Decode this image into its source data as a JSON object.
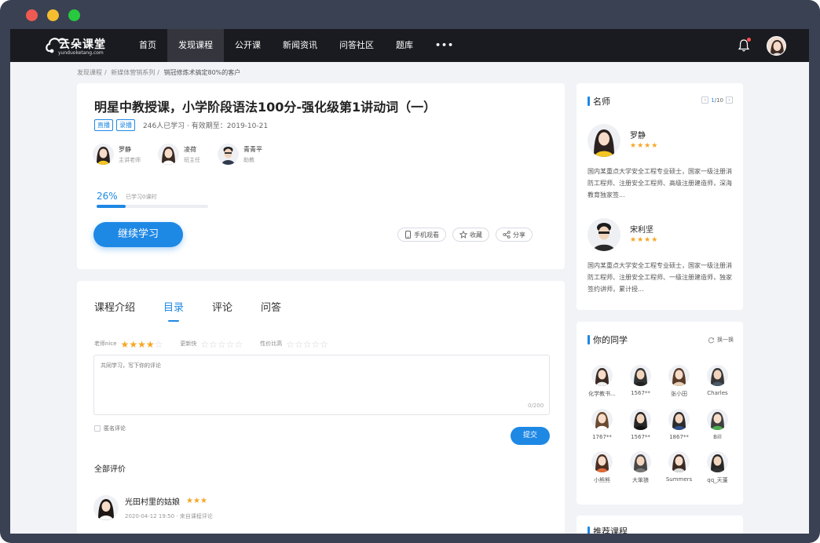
{
  "nav": {
    "logo_text": "云朵课堂",
    "logo_sub": "yunduoketang.com",
    "items": [
      {
        "label": "首页",
        "active": false
      },
      {
        "label": "发现课程",
        "active": true
      },
      {
        "label": "公开课",
        "active": false
      },
      {
        "label": "新闻资讯",
        "active": false
      },
      {
        "label": "问答社区",
        "active": false
      },
      {
        "label": "题库",
        "active": false
      }
    ],
    "more_label": "•••"
  },
  "breadcrumb": [
    "发现课程",
    "新媒体营销系列",
    "销冠修炼术搞定80%的客户"
  ],
  "course": {
    "title": "明星中教授课，小学阶段语法100分-强化级第1讲动词（一）",
    "tags": [
      "直播",
      "录播"
    ],
    "meta": "246人已学习 · 有效期至：2019-10-21",
    "teachers": [
      {
        "name": "罗静",
        "role": "主讲老师"
      },
      {
        "name": "凌荷",
        "role": "班主任"
      },
      {
        "name": "青青平",
        "role": "助教"
      }
    ],
    "progress_text": "26%",
    "progress_value": 0.26,
    "progress_note": "已学习0课时",
    "continue_label": "继续学习",
    "actions": {
      "mobile": "手机观看",
      "favorite": "收藏",
      "share": "分享"
    }
  },
  "tabs": [
    {
      "label": "课程介绍",
      "active": false
    },
    {
      "label": "目录",
      "active": true
    },
    {
      "label": "评论",
      "active": false
    },
    {
      "label": "问答",
      "active": false
    }
  ],
  "ratings": [
    {
      "label": "老师nice",
      "stars": 4
    },
    {
      "label": "更新快",
      "stars": 0
    },
    {
      "label": "性价比高",
      "stars": 0
    }
  ],
  "comment": {
    "placeholder": "共同学习，写下你的评论",
    "counter": "0/200",
    "anonymous_label": "匿名评论",
    "submit_label": "提交"
  },
  "reviews": {
    "heading": "全部评价",
    "items": [
      {
        "name": "光田村里的姑娘",
        "stars": 3,
        "meta": "2020-04-12 19:50 · 来自课程评论"
      }
    ]
  },
  "famous_teachers": {
    "title": "名师",
    "pager": {
      "current": "1",
      "total": "/10"
    },
    "items": [
      {
        "name": "罗静",
        "stars": 4,
        "desc": "国内某重点大学安全工程专业硕士，国家一级注册消防工程师、注册安全工程师、高级注册建造师，深海教育独家签..."
      },
      {
        "name": "宋利坚",
        "stars": 4,
        "desc": "国内某重点大学安全工程专业硕士，国家一级注册消防工程师、注册安全工程师、一级注册建造师，独家签约讲师，累计授..."
      }
    ]
  },
  "classmates": {
    "title": "你的同学",
    "refresh_label": "换一换",
    "items": [
      "化学教书...",
      "1567**",
      "张小田",
      "Charles",
      "1767**",
      "1567**",
      "1867**",
      "Bill",
      "小熊熊",
      "大笨狼",
      "Summers",
      "qq_天蓬"
    ]
  },
  "recommend": {
    "title": "推荐课程"
  },
  "colors": {
    "accent": "#1e88e5",
    "star": "#f5a623",
    "nav_bg": "#1a1b20",
    "frame": "#3a4152"
  }
}
